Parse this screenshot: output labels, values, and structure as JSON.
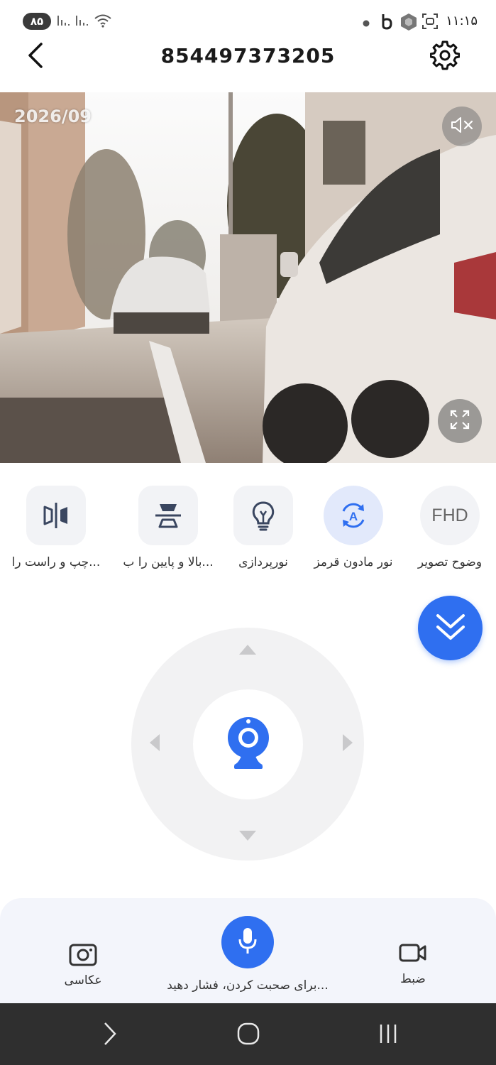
{
  "status_bar": {
    "battery": "۸۵",
    "time": "۱۱:۱۵",
    "icons": [
      "signal-icon",
      "signal-icon",
      "wifi-icon",
      "dot-icon",
      "b-icon",
      "hexagon-icon",
      "scan-icon"
    ]
  },
  "header": {
    "title": "854497373205",
    "back_icon": "back-arrow-icon",
    "settings_icon": "gear-icon"
  },
  "video": {
    "timestamp": "2026/09",
    "mute_icon": "speaker-muted-icon",
    "fullscreen_icon": "fullscreen-icon"
  },
  "functions": [
    {
      "id": "resolution",
      "label": "وضوح تصویر",
      "icon_text": "FHD",
      "icon": "fhd-icon"
    },
    {
      "id": "infrared",
      "label": "نور مادون قرمز",
      "icon": "auto-infrared-icon",
      "active": true
    },
    {
      "id": "lighting",
      "label": "نورپردازی",
      "icon": "lightbulb-icon"
    },
    {
      "id": "flip-vertical",
      "label": "...بالا و پایین را ب",
      "icon": "flip-vertical-icon"
    },
    {
      "id": "flip-horizontal",
      "label": "...چپ و راست را",
      "icon": "flip-horizontal-icon"
    }
  ],
  "collapse_icon": "double-chevron-down-icon",
  "ptz": {
    "center_icon": "webcam-icon",
    "up_icon": "arrow-up-icon",
    "down_icon": "arrow-down-icon",
    "left_icon": "arrow-left-icon",
    "right_icon": "arrow-right-icon"
  },
  "bottom": {
    "record_label": "ضبط",
    "talk_label": "...برای صحبت کردن، فشار دهید",
    "snapshot_label": "عکاسی"
  },
  "colors": {
    "accent": "#2f6ff0",
    "panel": "#f3f5fb",
    "icon_box": "#f2f3f6",
    "nav_bar": "#2f2f2f"
  }
}
